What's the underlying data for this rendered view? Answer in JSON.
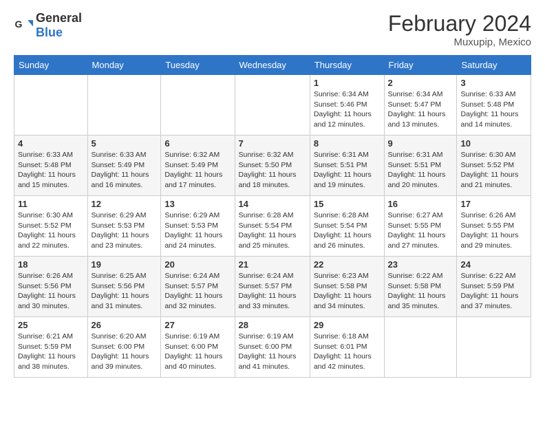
{
  "header": {
    "logo_general": "General",
    "logo_blue": "Blue",
    "month_year": "February 2024",
    "location": "Muxupip, Mexico"
  },
  "weekdays": [
    "Sunday",
    "Monday",
    "Tuesday",
    "Wednesday",
    "Thursday",
    "Friday",
    "Saturday"
  ],
  "weeks": [
    [
      {
        "day": "",
        "sunrise": "",
        "sunset": "",
        "daylight": ""
      },
      {
        "day": "",
        "sunrise": "",
        "sunset": "",
        "daylight": ""
      },
      {
        "day": "",
        "sunrise": "",
        "sunset": "",
        "daylight": ""
      },
      {
        "day": "",
        "sunrise": "",
        "sunset": "",
        "daylight": ""
      },
      {
        "day": "1",
        "sunrise": "Sunrise: 6:34 AM",
        "sunset": "Sunset: 5:46 PM",
        "daylight": "Daylight: 11 hours and 12 minutes."
      },
      {
        "day": "2",
        "sunrise": "Sunrise: 6:34 AM",
        "sunset": "Sunset: 5:47 PM",
        "daylight": "Daylight: 11 hours and 13 minutes."
      },
      {
        "day": "3",
        "sunrise": "Sunrise: 6:33 AM",
        "sunset": "Sunset: 5:48 PM",
        "daylight": "Daylight: 11 hours and 14 minutes."
      }
    ],
    [
      {
        "day": "4",
        "sunrise": "Sunrise: 6:33 AM",
        "sunset": "Sunset: 5:48 PM",
        "daylight": "Daylight: 11 hours and 15 minutes."
      },
      {
        "day": "5",
        "sunrise": "Sunrise: 6:33 AM",
        "sunset": "Sunset: 5:49 PM",
        "daylight": "Daylight: 11 hours and 16 minutes."
      },
      {
        "day": "6",
        "sunrise": "Sunrise: 6:32 AM",
        "sunset": "Sunset: 5:49 PM",
        "daylight": "Daylight: 11 hours and 17 minutes."
      },
      {
        "day": "7",
        "sunrise": "Sunrise: 6:32 AM",
        "sunset": "Sunset: 5:50 PM",
        "daylight": "Daylight: 11 hours and 18 minutes."
      },
      {
        "day": "8",
        "sunrise": "Sunrise: 6:31 AM",
        "sunset": "Sunset: 5:51 PM",
        "daylight": "Daylight: 11 hours and 19 minutes."
      },
      {
        "day": "9",
        "sunrise": "Sunrise: 6:31 AM",
        "sunset": "Sunset: 5:51 PM",
        "daylight": "Daylight: 11 hours and 20 minutes."
      },
      {
        "day": "10",
        "sunrise": "Sunrise: 6:30 AM",
        "sunset": "Sunset: 5:52 PM",
        "daylight": "Daylight: 11 hours and 21 minutes."
      }
    ],
    [
      {
        "day": "11",
        "sunrise": "Sunrise: 6:30 AM",
        "sunset": "Sunset: 5:52 PM",
        "daylight": "Daylight: 11 hours and 22 minutes."
      },
      {
        "day": "12",
        "sunrise": "Sunrise: 6:29 AM",
        "sunset": "Sunset: 5:53 PM",
        "daylight": "Daylight: 11 hours and 23 minutes."
      },
      {
        "day": "13",
        "sunrise": "Sunrise: 6:29 AM",
        "sunset": "Sunset: 5:53 PM",
        "daylight": "Daylight: 11 hours and 24 minutes."
      },
      {
        "day": "14",
        "sunrise": "Sunrise: 6:28 AM",
        "sunset": "Sunset: 5:54 PM",
        "daylight": "Daylight: 11 hours and 25 minutes."
      },
      {
        "day": "15",
        "sunrise": "Sunrise: 6:28 AM",
        "sunset": "Sunset: 5:54 PM",
        "daylight": "Daylight: 11 hours and 26 minutes."
      },
      {
        "day": "16",
        "sunrise": "Sunrise: 6:27 AM",
        "sunset": "Sunset: 5:55 PM",
        "daylight": "Daylight: 11 hours and 27 minutes."
      },
      {
        "day": "17",
        "sunrise": "Sunrise: 6:26 AM",
        "sunset": "Sunset: 5:55 PM",
        "daylight": "Daylight: 11 hours and 29 minutes."
      }
    ],
    [
      {
        "day": "18",
        "sunrise": "Sunrise: 6:26 AM",
        "sunset": "Sunset: 5:56 PM",
        "daylight": "Daylight: 11 hours and 30 minutes."
      },
      {
        "day": "19",
        "sunrise": "Sunrise: 6:25 AM",
        "sunset": "Sunset: 5:56 PM",
        "daylight": "Daylight: 11 hours and 31 minutes."
      },
      {
        "day": "20",
        "sunrise": "Sunrise: 6:24 AM",
        "sunset": "Sunset: 5:57 PM",
        "daylight": "Daylight: 11 hours and 32 minutes."
      },
      {
        "day": "21",
        "sunrise": "Sunrise: 6:24 AM",
        "sunset": "Sunset: 5:57 PM",
        "daylight": "Daylight: 11 hours and 33 minutes."
      },
      {
        "day": "22",
        "sunrise": "Sunrise: 6:23 AM",
        "sunset": "Sunset: 5:58 PM",
        "daylight": "Daylight: 11 hours and 34 minutes."
      },
      {
        "day": "23",
        "sunrise": "Sunrise: 6:22 AM",
        "sunset": "Sunset: 5:58 PM",
        "daylight": "Daylight: 11 hours and 35 minutes."
      },
      {
        "day": "24",
        "sunrise": "Sunrise: 6:22 AM",
        "sunset": "Sunset: 5:59 PM",
        "daylight": "Daylight: 11 hours and 37 minutes."
      }
    ],
    [
      {
        "day": "25",
        "sunrise": "Sunrise: 6:21 AM",
        "sunset": "Sunset: 5:59 PM",
        "daylight": "Daylight: 11 hours and 38 minutes."
      },
      {
        "day": "26",
        "sunrise": "Sunrise: 6:20 AM",
        "sunset": "Sunset: 6:00 PM",
        "daylight": "Daylight: 11 hours and 39 minutes."
      },
      {
        "day": "27",
        "sunrise": "Sunrise: 6:19 AM",
        "sunset": "Sunset: 6:00 PM",
        "daylight": "Daylight: 11 hours and 40 minutes."
      },
      {
        "day": "28",
        "sunrise": "Sunrise: 6:19 AM",
        "sunset": "Sunset: 6:00 PM",
        "daylight": "Daylight: 11 hours and 41 minutes."
      },
      {
        "day": "29",
        "sunrise": "Sunrise: 6:18 AM",
        "sunset": "Sunset: 6:01 PM",
        "daylight": "Daylight: 11 hours and 42 minutes."
      },
      {
        "day": "",
        "sunrise": "",
        "sunset": "",
        "daylight": ""
      },
      {
        "day": "",
        "sunrise": "",
        "sunset": "",
        "daylight": ""
      }
    ]
  ]
}
